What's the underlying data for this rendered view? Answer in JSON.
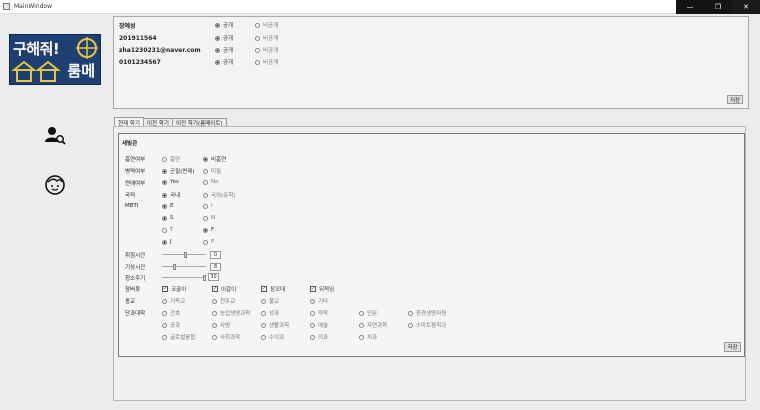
{
  "window": {
    "title": "MainWindow"
  },
  "logo": {
    "line1": "구해줘!",
    "line2": "룸메"
  },
  "profile": {
    "rows": [
      {
        "value": "장예성",
        "on": "공개",
        "off": "비공개"
      },
      {
        "value": "201911564",
        "on": "공개",
        "off": "비공개"
      },
      {
        "value": "zha1230231@naver.com",
        "on": "공개",
        "off": "비공개"
      },
      {
        "value": "0101234567",
        "on": "공개",
        "off": "비공개"
      }
    ],
    "save_label": "저장"
  },
  "tabs": [
    "현재 학기",
    "이전 학기",
    "이전 학기(룸메이트)"
  ],
  "dorm": {
    "name": "새빛관"
  },
  "form": {
    "smoking": {
      "label": "흡연여부",
      "options": [
        "흡연",
        "비흡연"
      ]
    },
    "military": {
      "label": "병역여부",
      "options": [
        "군필(면제)",
        "미필"
      ]
    },
    "religion_yn": {
      "label": "연애여부",
      "options": [
        "Yes",
        "No"
      ]
    },
    "nationality": {
      "label": "국적",
      "options": [
        "국내",
        "국외(유학)"
      ]
    },
    "mbti": {
      "label": "MBTI",
      "pairs": [
        [
          "E",
          "I"
        ],
        [
          "S",
          "N"
        ],
        [
          "T",
          "F"
        ],
        [
          "J",
          "P"
        ]
      ]
    },
    "sleep": {
      "label": "취침시간",
      "value": "0"
    },
    "wake": {
      "label": "기상시간",
      "value": "8"
    },
    "clean": {
      "label": "청소주기",
      "value": "30"
    },
    "habits": {
      "label": "잠버릇",
      "options": [
        "코골이",
        "이갈이",
        "잠꼬대",
        "뒤척임"
      ]
    },
    "religion": {
      "label": "종교",
      "options": [
        "기독교",
        "천주교",
        "불교",
        "기타"
      ]
    },
    "college": {
      "label": "단과대학",
      "options": [
        "간호",
        "농업생명과학",
        "상과",
        "약학",
        "인문",
        "환경생명자원",
        "공과",
        "사범",
        "생활과학",
        "예술",
        "자연과학",
        "스마트팜학과",
        "글로벌융합",
        "사회과학",
        "수의과",
        "의과",
        "치과"
      ]
    },
    "save_label": "저장"
  },
  "colors": {
    "logo_bg": "#1e3f72",
    "panel_border": "#a8a8a8"
  }
}
